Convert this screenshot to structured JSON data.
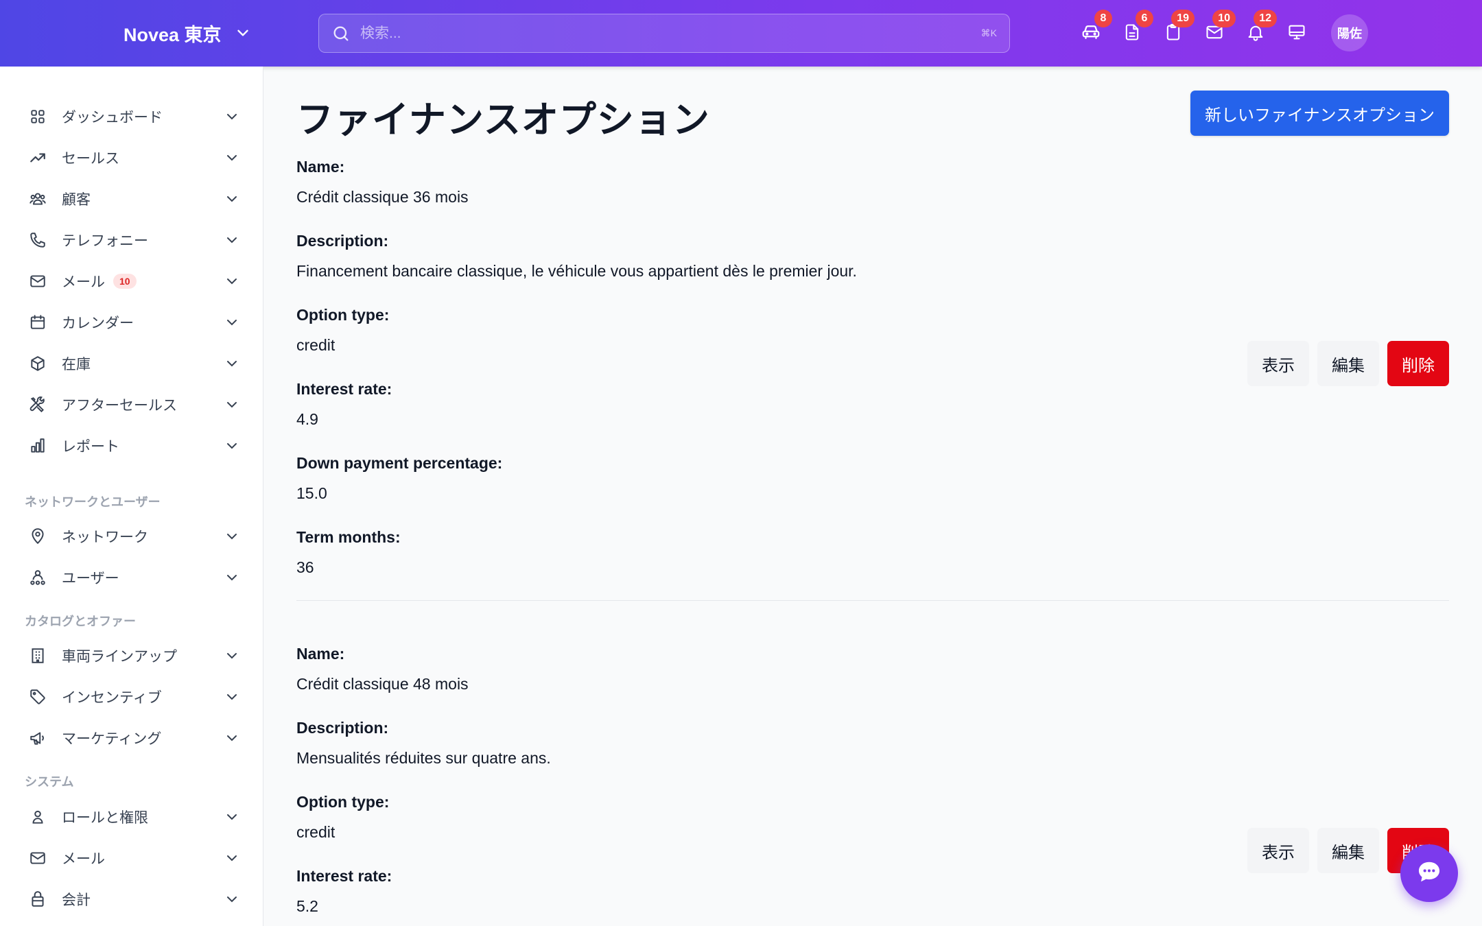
{
  "header": {
    "brand": "Novea 東京",
    "search_placeholder": "検索...",
    "search_shortcut": "⌘K",
    "icons": [
      {
        "name": "car-icon",
        "badge": "8"
      },
      {
        "name": "document-icon",
        "badge": "6"
      },
      {
        "name": "clipboard-icon",
        "badge": "19"
      },
      {
        "name": "mail-icon",
        "badge": "10"
      },
      {
        "name": "bell-icon",
        "badge": "12"
      },
      {
        "name": "monitor-icon",
        "badge": ""
      }
    ],
    "avatar": "陽佐"
  },
  "sidebar": {
    "items": [
      {
        "label": "ダッシュボード",
        "icon": "dashboard-grid-icon"
      },
      {
        "label": "セールス",
        "icon": "trend-up-icon"
      },
      {
        "label": "顧客",
        "icon": "users-icon"
      },
      {
        "label": "テレフォニー",
        "icon": "phone-icon"
      },
      {
        "label": "メール",
        "icon": "mail-icon",
        "badge": "10"
      },
      {
        "label": "カレンダー",
        "icon": "calendar-icon"
      },
      {
        "label": "在庫",
        "icon": "box-icon"
      },
      {
        "label": "アフターセールス",
        "icon": "tools-icon"
      },
      {
        "label": "レポート",
        "icon": "bar-chart-icon"
      }
    ],
    "section_network": "ネットワークとユーザー",
    "network_items": [
      {
        "label": "ネットワーク",
        "icon": "map-pin-icon"
      },
      {
        "label": "ユーザー",
        "icon": "user-network-icon"
      }
    ],
    "section_catalog": "カタログとオファー",
    "catalog_items": [
      {
        "label": "車両ラインアップ",
        "icon": "building-icon"
      },
      {
        "label": "インセンティブ",
        "icon": "tag-icon"
      },
      {
        "label": "マーケティング",
        "icon": "megaphone-icon"
      }
    ],
    "section_system": "システム",
    "system_items": [
      {
        "label": "ロールと権限",
        "icon": "user-icon"
      },
      {
        "label": "メール",
        "icon": "mail-icon"
      },
      {
        "label": "会計",
        "icon": "lock-bag-icon"
      }
    ]
  },
  "main": {
    "title": "ファイナンスオプション",
    "new_button": "新しいファイナンスオプション",
    "labels": {
      "name": "Name:",
      "description": "Description:",
      "option_type": "Option type:",
      "interest_rate": "Interest rate:",
      "down_payment": "Down payment percentage:",
      "term_months": "Term months:"
    },
    "actions": {
      "show": "表示",
      "edit": "編集",
      "delete": "削除"
    },
    "records": [
      {
        "name": "Crédit classique 36 mois",
        "description": "Financement bancaire classique, le véhicule vous appartient dès le premier jour.",
        "option_type": "credit",
        "interest_rate": "4.9",
        "down_payment": "15.0",
        "term_months": "36"
      },
      {
        "name": "Crédit classique 48 mois",
        "description": "Mensualités réduites sur quatre ans.",
        "option_type": "credit",
        "interest_rate": "5.2"
      }
    ]
  },
  "colors": {
    "header_gradient_start": "#4f46e5",
    "header_gradient_end": "#9333ea",
    "primary": "#2563eb",
    "danger": "#e30613",
    "badge": "#ef4444",
    "fab": "#7c3aed"
  },
  "fab_icon": "chat-icon"
}
